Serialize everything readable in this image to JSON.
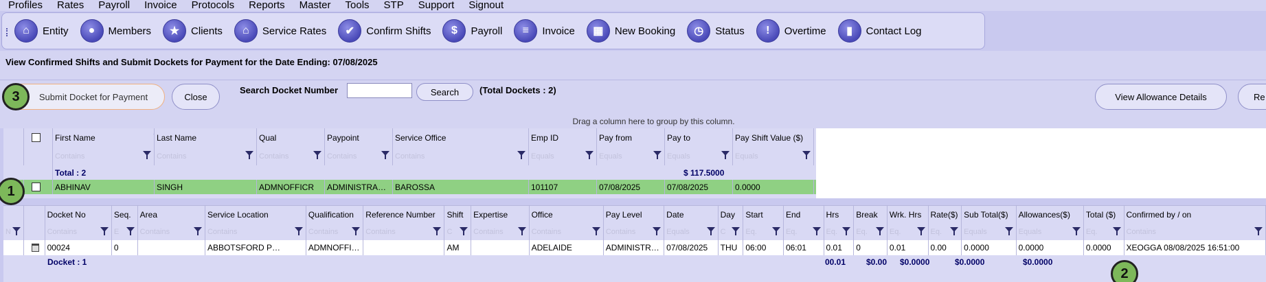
{
  "menu": [
    "Profiles",
    "Rates",
    "Payroll",
    "Invoice",
    "Protocols",
    "Reports",
    "Master",
    "Tools",
    "STP",
    "Support",
    "Signout"
  ],
  "toolbar": [
    {
      "label": "Entity",
      "icon": "building-icon",
      "glyph": "⌂"
    },
    {
      "label": "Members",
      "icon": "person-icon",
      "glyph": "●"
    },
    {
      "label": "Clients",
      "icon": "star-icon",
      "glyph": "★"
    },
    {
      "label": "Service Rates",
      "icon": "house-icon",
      "glyph": "⌂"
    },
    {
      "label": "Confirm Shifts",
      "icon": "check-icon",
      "glyph": "✔"
    },
    {
      "label": "Payroll",
      "icon": "dollar-icon",
      "glyph": "$"
    },
    {
      "label": "Invoice",
      "icon": "document-icon",
      "glyph": "≡"
    },
    {
      "label": "New Booking",
      "icon": "calendar-icon",
      "glyph": "▦"
    },
    {
      "label": "Status",
      "icon": "clock-icon",
      "glyph": "◷"
    },
    {
      "label": "Overtime",
      "icon": "exclamation-icon",
      "glyph": "!"
    },
    {
      "label": "Contact Log",
      "icon": "book-icon",
      "glyph": "▮"
    }
  ],
  "page": {
    "title": "View Confirmed Shifts and Submit Dockets for Payment for the Date Ending: 07/08/2025"
  },
  "actions": {
    "submit_label": "Submit Docket for Payment",
    "close_label": "Close",
    "search_label": "Search Docket Number",
    "search_value": "",
    "search_button": "Search",
    "total_dockets": "(Total Dockets : 2)",
    "allowance_label": "View Allowance Details",
    "re_label": "Re"
  },
  "markers": {
    "one": "1",
    "two": "2",
    "three": "3"
  },
  "group_hint": "Drag a column here to group by this column.",
  "grid1": {
    "headers": [
      "First Name",
      "Last Name",
      "Qual",
      "Paypoint",
      "Service Office",
      "Emp ID",
      "Pay from",
      "Pay to",
      "Pay Shift Value ($)"
    ],
    "filters": [
      "Contains",
      "Contains",
      "Contains",
      "Contains",
      "Contains",
      "Equals",
      "Equals",
      "Equals",
      "Equals"
    ],
    "total_label": "Total : 2",
    "total_value": "$ 117.5000",
    "row": [
      "ABHINAV",
      "SINGH",
      "ADMNOFFICR",
      "ADMINISTRA…",
      "BAROSSA",
      "101107",
      "07/08/2025",
      "07/08/2025",
      "0.0000"
    ]
  },
  "grid2": {
    "headers": [
      "Docket No",
      "Seq.",
      "Area",
      "Service Location",
      "Qualification",
      "Reference Number",
      "Shift",
      "Expertise",
      "Office",
      "Pay Level",
      "Date",
      "Day",
      "Start",
      "End",
      "Hrs",
      "Break",
      "Wrk. Hrs",
      "Rate($)",
      "Sub Total($)",
      "Allowances($)",
      "Total ($)",
      "Confirmed by / on"
    ],
    "filters": [
      "Contains",
      "E",
      "Contains",
      "Contains",
      "Contains",
      "Contains",
      "C",
      "Contains",
      "Contains",
      "Contains",
      "Equals",
      "C",
      "Eq.",
      "Eq.",
      "Eq.",
      "Eq.",
      "Eq.",
      "Eq.",
      "Equals",
      "Equals",
      "Eq.",
      "Contains"
    ],
    "filter_first": "N",
    "row": [
      "00024",
      "0",
      "",
      "ABBOTSFORD  P…",
      "ADMNOFFI…",
      "",
      "AM",
      "",
      "ADELAIDE",
      "ADMINISTR…",
      "07/08/2025",
      "THU",
      "06:00",
      "06:01",
      "0.01",
      "0",
      "0.01",
      "0.00",
      "0.0000",
      "0.0000",
      "0.0000",
      "XEOGGA 08/08/2025 16:51:00"
    ],
    "footer_label": "Docket : 1",
    "footer_wrk": "00.01",
    "footer_rate": "$0.00",
    "footer_sub": "$0.0000",
    "footer_allow": "$0.0000",
    "footer_total": "$0.0000"
  }
}
